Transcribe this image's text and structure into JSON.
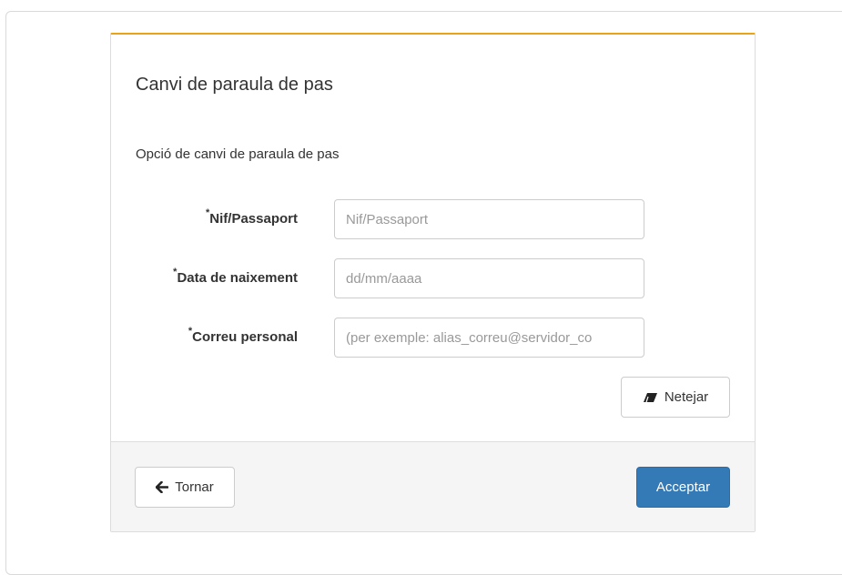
{
  "panel": {
    "title": "Canvi de paraula de pas",
    "subtitle": "Opció de canvi de paraula de pas",
    "accent_color": "#e8a317"
  },
  "form": {
    "required_marker": "*",
    "fields": [
      {
        "label": "Nif/Passaport",
        "placeholder": "Nif/Passaport",
        "value": ""
      },
      {
        "label": "Data de naixement",
        "placeholder": "dd/mm/aaaa",
        "value": ""
      },
      {
        "label": "Correu personal",
        "placeholder": "(per exemple: alias_correu@servidor_co",
        "value": ""
      }
    ],
    "clear_button": {
      "label": "Netejar",
      "icon": "eraser-icon"
    }
  },
  "footer": {
    "back_button": {
      "label": "Tornar",
      "icon": "arrow-left-icon"
    },
    "accept_button": {
      "label": "Acceptar",
      "color": "#337ab7"
    }
  }
}
